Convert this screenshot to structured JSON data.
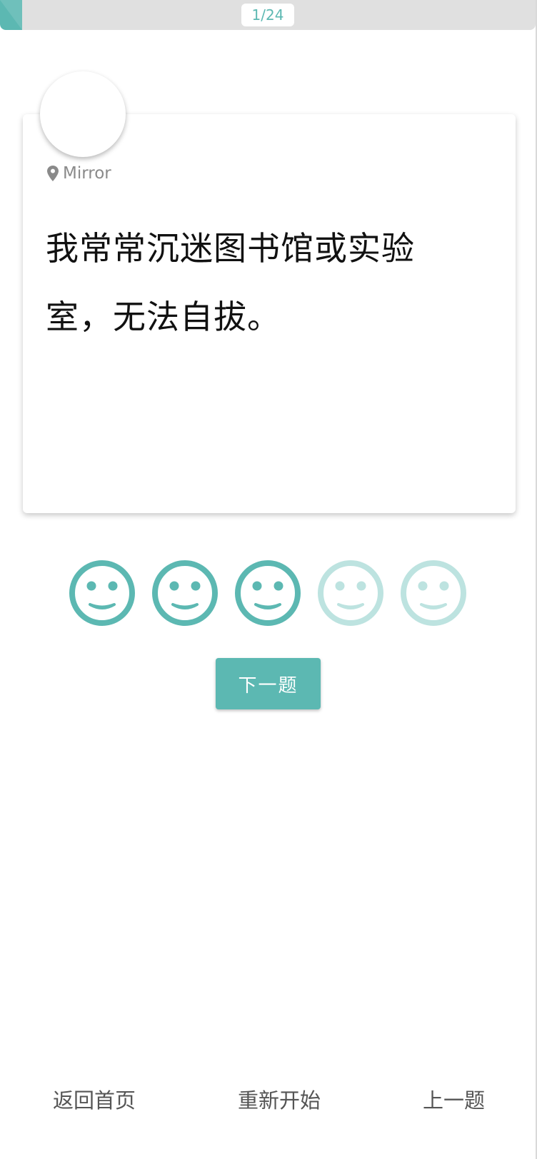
{
  "progress": {
    "label": "1/24",
    "current": 1,
    "total": 24
  },
  "card": {
    "location_icon": "map-pin-icon",
    "location_label": "Mirror",
    "question_line1": "我常常沉迷图书馆或实验",
    "question_line2": "室，无法自拔。"
  },
  "ratings": {
    "icon": "smiley-face-icon",
    "count": 5,
    "selected": 3,
    "active_color": "#5cb8b2",
    "inactive_color": "#bde3e0"
  },
  "actions": {
    "next_label": "下一题"
  },
  "footer": {
    "home_label": "返回首页",
    "restart_label": "重新开始",
    "prev_label": "上一题"
  },
  "colors": {
    "accent": "#5cb8b2",
    "track": "#e0e0e0"
  }
}
